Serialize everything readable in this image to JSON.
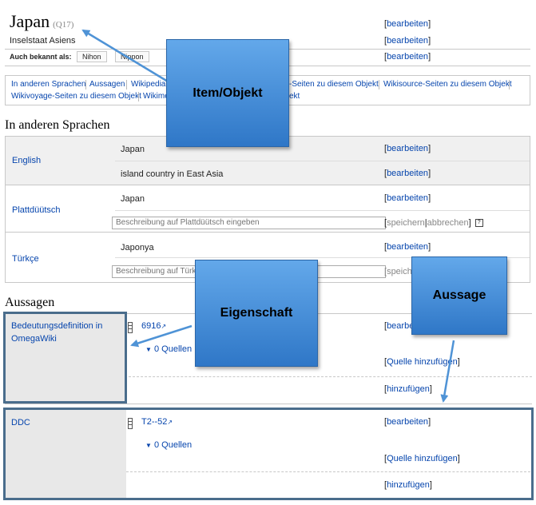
{
  "header": {
    "title": "Japan",
    "qid": "(Q17)",
    "description": "Inselstaat Asiens",
    "aliases_label": "Auch bekannt als:",
    "aliases": [
      "Nihon",
      "Nippon"
    ],
    "edit_label": "bearbeiten"
  },
  "links_box": {
    "row1": [
      "In anderen Sprachen",
      "Aussagen",
      "Wikipedia-S",
      "-Seiten zu diesem Objekt",
      "Wikisource-Seiten zu diesem Objekt"
    ],
    "row2": [
      "Wikivoyage-Seiten zu diesem Objekt",
      "Wikime",
      "ekt"
    ]
  },
  "languages_section": {
    "heading": "In anderen Sprachen",
    "rows": [
      {
        "language": "English",
        "label": "Japan",
        "description": "island country in East Asia"
      },
      {
        "language": "Plattdüütsch",
        "label": "Japan",
        "description_placeholder": "Beschreibung auf Plattdüütsch eingeben"
      },
      {
        "language": "Türkçe",
        "label": "Japonya",
        "description_placeholder": "Beschreibung auf Türkçe"
      }
    ],
    "save_label": "speichern",
    "cancel_label": "abbrechen",
    "help_label": "?",
    "partial_save": "speich"
  },
  "statements_section": {
    "heading": "Aussagen",
    "statements": [
      {
        "property": "Bedeutungsdefinition in OmegaWiki",
        "value": "6916",
        "edit": "bearbe",
        "sources": "0 Quellen",
        "add_source": "Quelle hinzufügen",
        "add": "hinzufügen"
      },
      {
        "property": "DDC",
        "value": "T2--52",
        "edit": "bearbeiten",
        "sources": "0 Quellen",
        "add_source": "Quelle hinzufügen",
        "add": "hinzufügen"
      }
    ]
  },
  "callouts": {
    "item": "Item/Objekt",
    "property": "Eigenschaft",
    "statement": "Aussage"
  },
  "colors": {
    "link": "#0645ad",
    "callout_top": "#63a8ea",
    "callout_bottom": "#2f77c7",
    "frame": "#4a6d8c",
    "arrow": "#4f93d6"
  },
  "icons": {
    "external_link": "external-link-icon",
    "triangle": "triangle-down-icon",
    "drag_handle": "drag-handle-icon"
  }
}
